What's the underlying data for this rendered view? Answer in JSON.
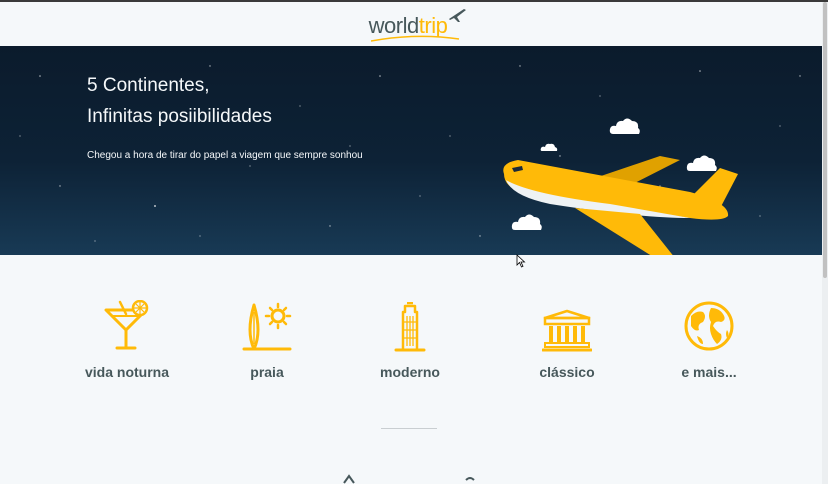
{
  "header": {
    "logo_world": "world",
    "logo_trip": "trip"
  },
  "hero": {
    "title_line1": "5 Continentes,",
    "title_line2": "Infinitas posiibilidades",
    "subtitle": "Chegou a hora de tirar do papel a viagem que sempre sonhou"
  },
  "travel_types": [
    {
      "label": "vida noturna",
      "icon": "cocktail-icon"
    },
    {
      "label": "praia",
      "icon": "surfboard-sun-icon"
    },
    {
      "label": "moderno",
      "icon": "skyscraper-icon"
    },
    {
      "label": "clássico",
      "icon": "colosseum-icon"
    },
    {
      "label": "e mais...",
      "icon": "globe-icon"
    }
  ],
  "colors": {
    "accent": "#ffba08",
    "text": "#47585b",
    "hero_bg": "#0d2236",
    "page_bg": "#f5f8fa"
  }
}
